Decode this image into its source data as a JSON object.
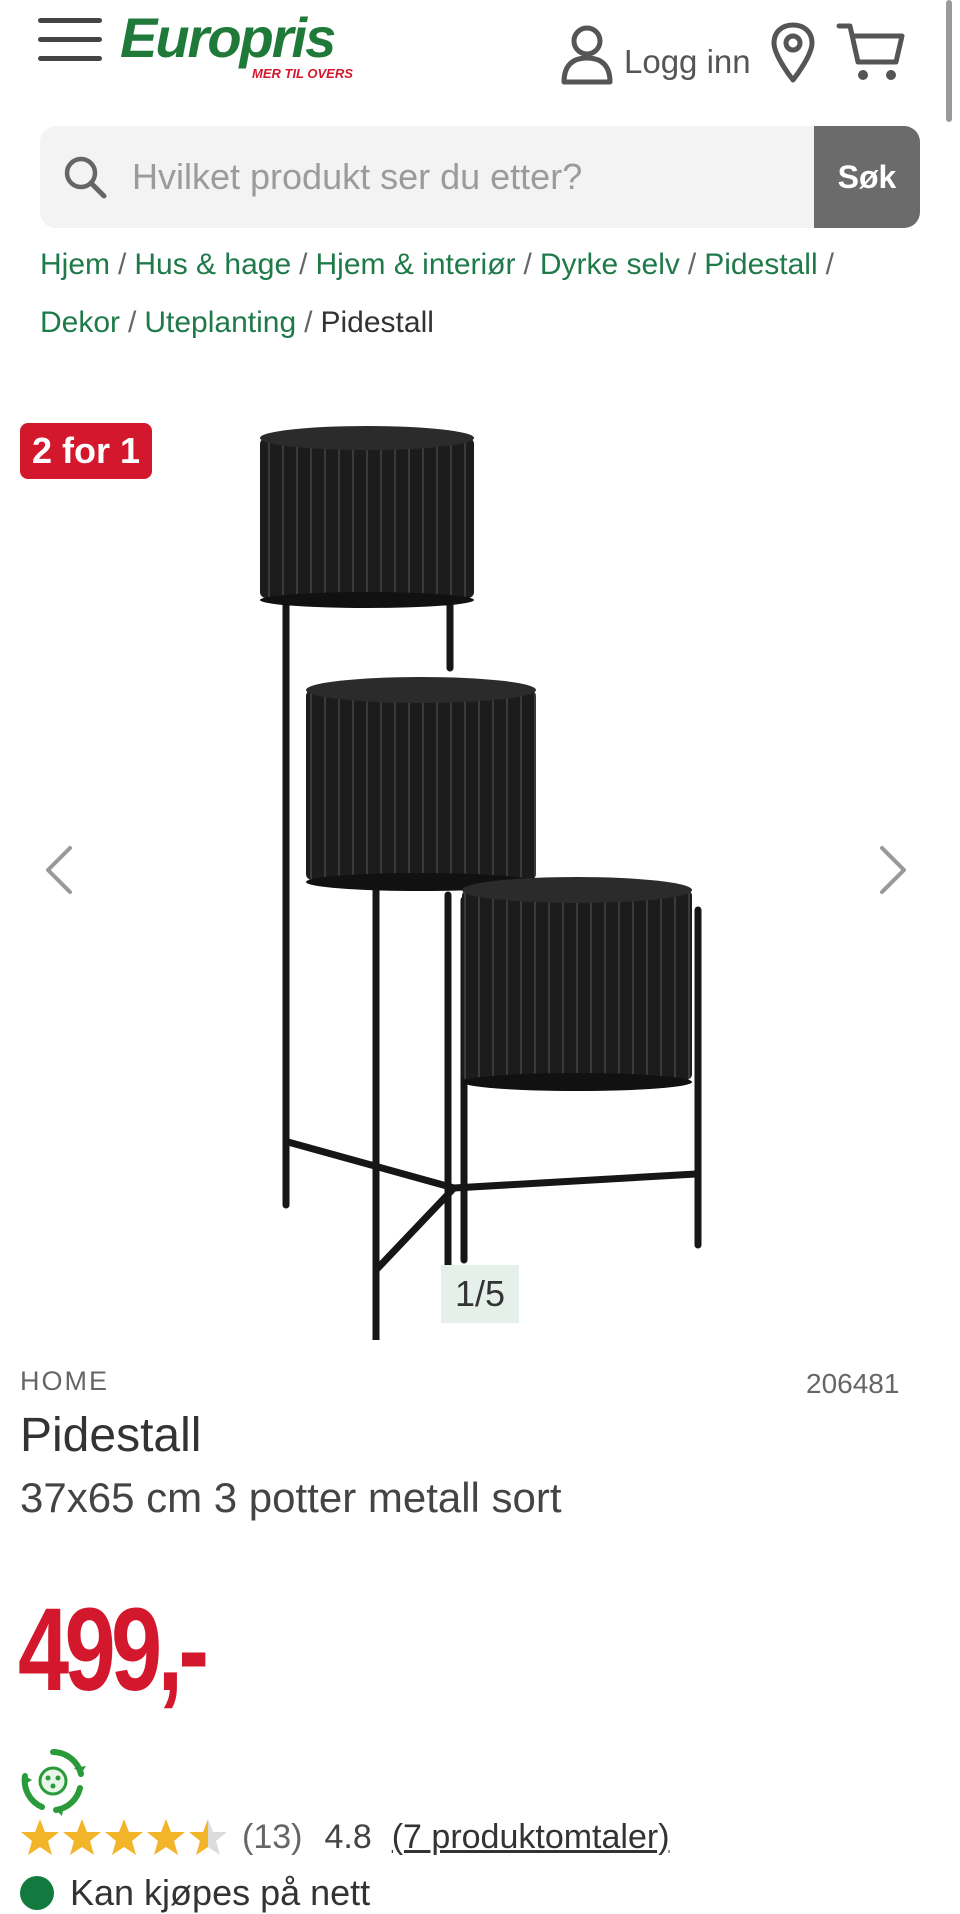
{
  "header": {
    "logo_text": "Europris",
    "logo_tagline": "MER TIL OVERS",
    "login_label": "Logg inn"
  },
  "search": {
    "placeholder": "Hvilket produkt ser du etter?",
    "button_label": "Søk"
  },
  "breadcrumb": {
    "items": [
      "Hjem",
      "Hus & hage",
      "Hjem & interiør",
      "Dyrke selv",
      "Pidestall",
      "Dekor",
      "Uteplanting"
    ],
    "separator": "/",
    "current": "Pidestall"
  },
  "gallery": {
    "badge": "2 for 1",
    "counter": "1/5"
  },
  "product": {
    "brand": "HOME",
    "sku": "206481",
    "title": "Pidestall",
    "subtitle": "37x65 cm 3 potter metall sort",
    "price": "499,-"
  },
  "rating": {
    "stars": 4.5,
    "count": "(13)",
    "score": "4.8",
    "reviews_link": "(7 produktomtaler)"
  },
  "availability": {
    "label": "Kan kjøpes på nett"
  },
  "icons": {
    "menu": "hamburger-menu-icon",
    "user": "user-icon",
    "location": "location-pin-icon",
    "cart": "shopping-cart-icon",
    "search": "search-icon",
    "prev": "chevron-left-icon",
    "next": "chevron-right-icon",
    "eco": "recycle-eco-icon"
  },
  "colors": {
    "brand_green": "#1f7a3a",
    "brand_red": "#d3182e",
    "link_green": "#1f7a4a",
    "star_gold": "#f2b52a",
    "available_green": "#137a3f",
    "search_button": "#6b6b6b"
  }
}
